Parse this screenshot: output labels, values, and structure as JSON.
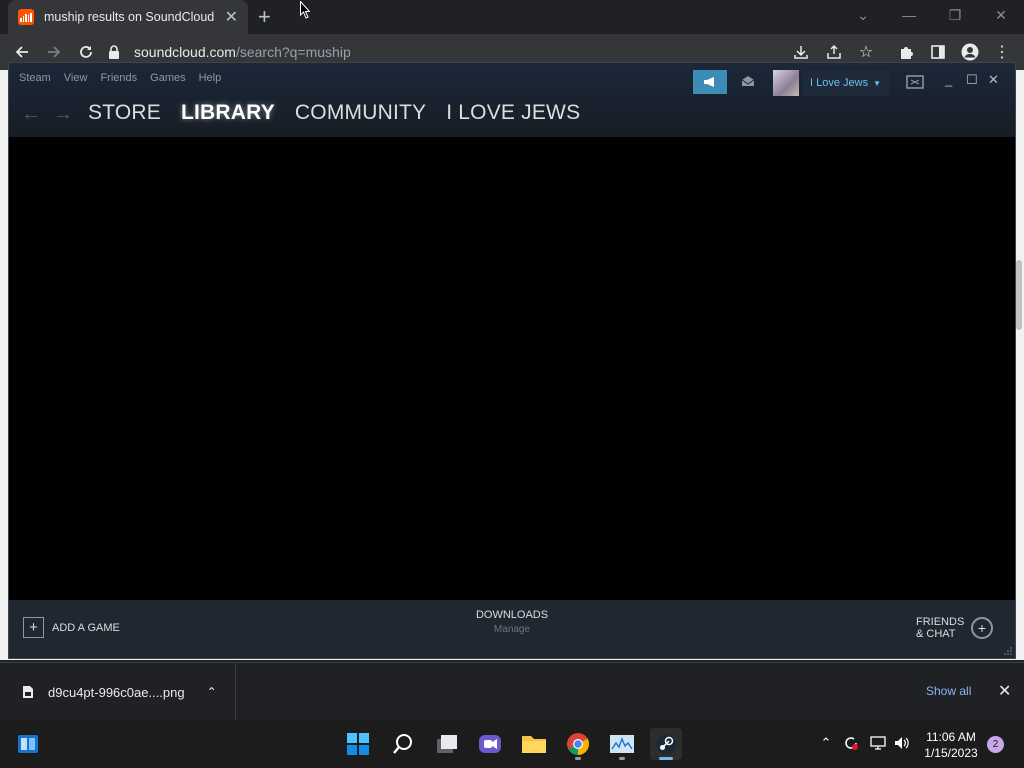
{
  "browser": {
    "tab_title": "muship results on SoundCloud",
    "url_host": "soundcloud.com",
    "url_path": "/search?q=muship",
    "accent_color": "#ff5500"
  },
  "steam": {
    "menu": [
      "Steam",
      "View",
      "Friends",
      "Games",
      "Help"
    ],
    "account_name": "I Love Jews",
    "nav_tabs": [
      "STORE",
      "LIBRARY",
      "COMMUNITY",
      "I LOVE JEWS"
    ],
    "active_tab": "LIBRARY",
    "add_game_label": "ADD A GAME",
    "downloads_title": "DOWNLOADS",
    "downloads_sub": "Manage",
    "friends_line1": "FRIENDS",
    "friends_line2": "& CHAT",
    "accent_color": "#3d8cb5"
  },
  "downloads_shelf": {
    "file_name": "d9cu4pt-996c0ae....png",
    "show_all": "Show all"
  },
  "taskbar": {
    "time": "11:06 AM",
    "date": "1/15/2023",
    "notification_count": "2"
  },
  "icons": [
    "soundcloud-favicon",
    "tab-close-icon",
    "new-tab-icon",
    "back-icon",
    "forward-icon",
    "reload-icon",
    "lock-icon",
    "download-icon",
    "share-icon",
    "bookmark-star-icon",
    "extensions-icon",
    "side-panel-icon",
    "profile-icon",
    "more-menu-icon",
    "megaphone-icon",
    "mail-icon",
    "windows-start-icon",
    "search-icon",
    "task-view-icon",
    "meet-icon",
    "file-explorer-icon",
    "chrome-icon",
    "monitor-app-icon",
    "steam-icon",
    "volume-icon",
    "network-icon"
  ]
}
